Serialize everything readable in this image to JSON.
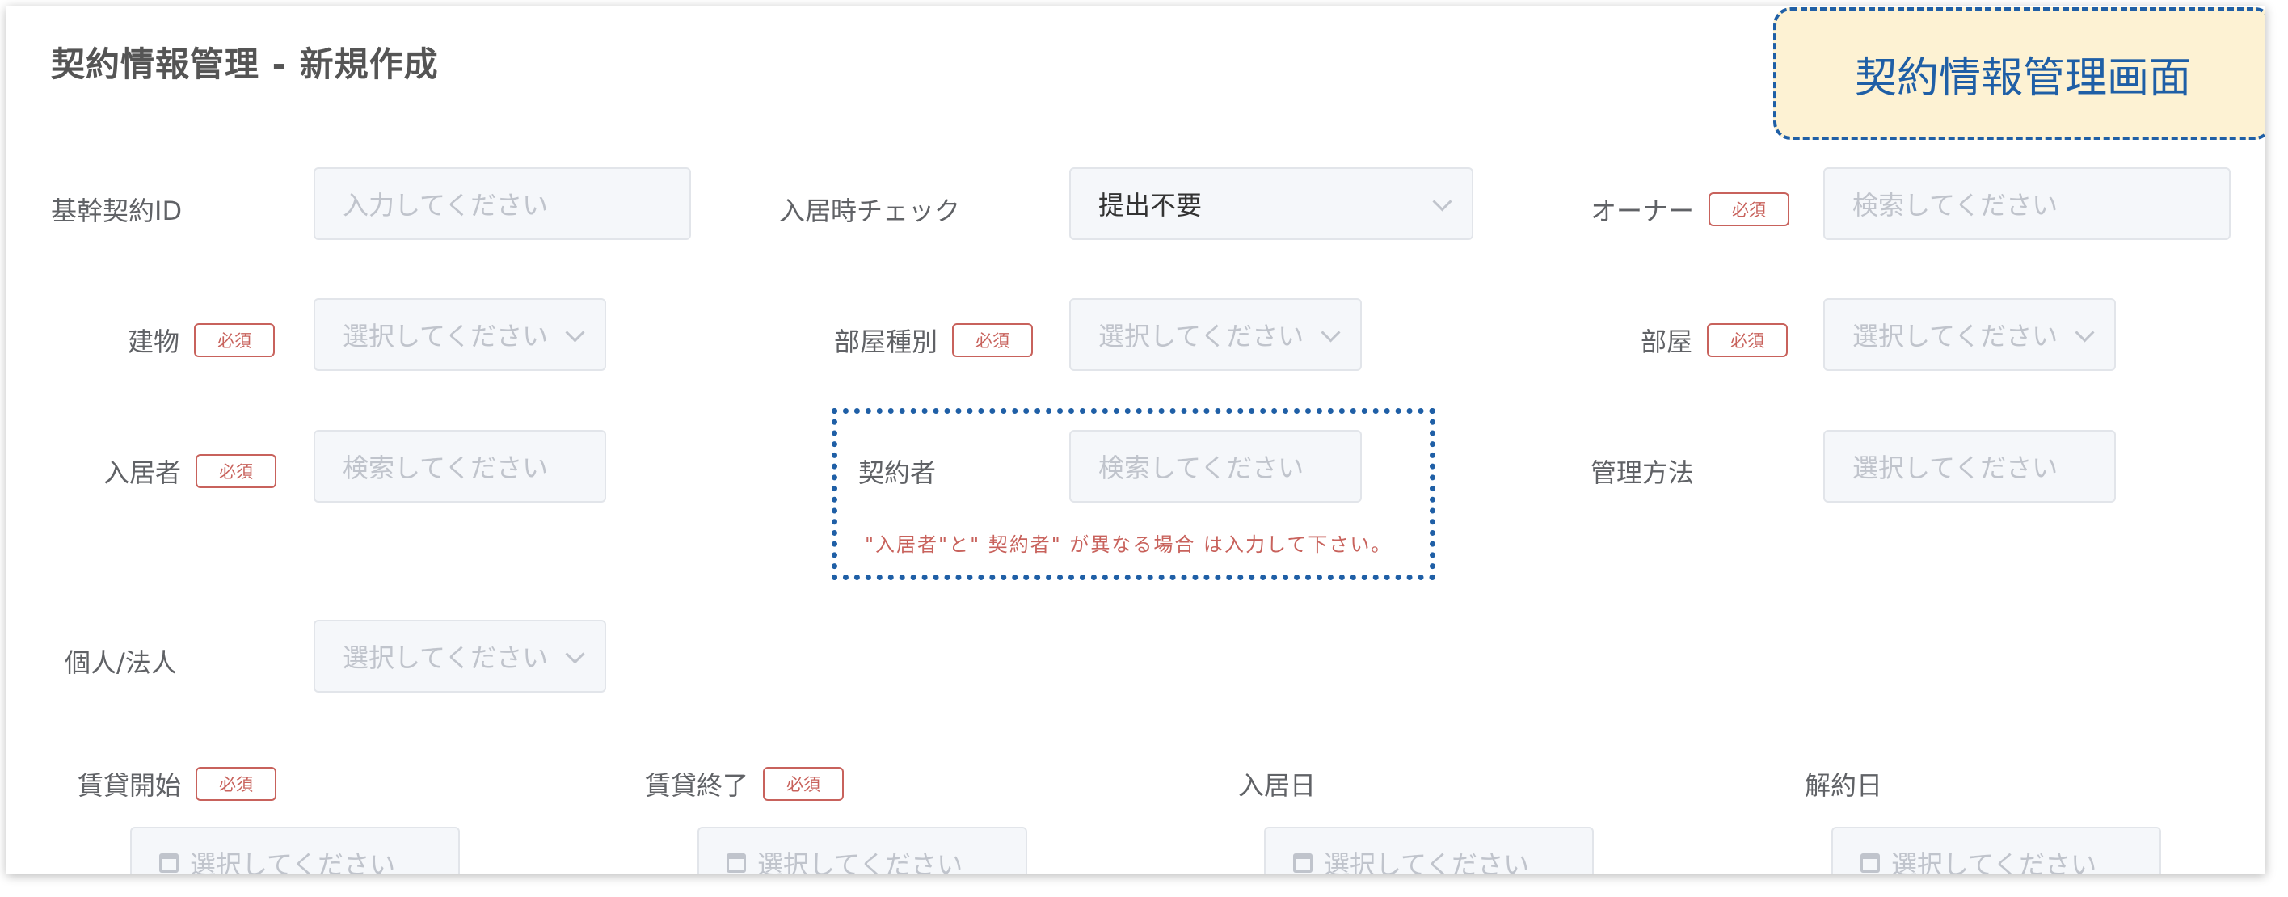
{
  "header": {
    "title": "契約情報管理 - 新規作成"
  },
  "callout": {
    "text": "契約情報管理画面"
  },
  "required_badge": "必須",
  "fields": {
    "base_contract_id": {
      "label": "基幹契約ID",
      "placeholder": "入力してください"
    },
    "move_in_check": {
      "label": "入居時チェック",
      "value": "提出不要"
    },
    "owner": {
      "label": "オーナー",
      "placeholder": "検索してください"
    },
    "building": {
      "label": "建物",
      "placeholder": "選択してください"
    },
    "room_type": {
      "label": "部屋種別",
      "placeholder": "選択してください"
    },
    "room": {
      "label": "部屋",
      "placeholder": "選択してください"
    },
    "resident": {
      "label": "入居者",
      "placeholder": "検索してください"
    },
    "contractor": {
      "label": "契約者",
      "placeholder": "検索してください"
    },
    "management_method": {
      "label": "管理方法",
      "placeholder": "選択してください"
    },
    "individual_corporate": {
      "label": "個人/法人",
      "placeholder": "選択してください"
    },
    "lease_start": {
      "label": "賃貸開始",
      "placeholder": "選択してください"
    },
    "lease_end": {
      "label": "賃貸終了",
      "placeholder": "選択してください"
    },
    "move_in_date": {
      "label": "入居日",
      "placeholder": "選択してください"
    },
    "cancellation_date": {
      "label": "解約日",
      "placeholder": "選択してください"
    }
  },
  "contractor_note": "\"入居者\"と\" 契約者\" が異なる場合 は入力して下さい。",
  "icons": {
    "select": "chevron-down-icon",
    "date": "calendar-icon"
  },
  "colors": {
    "callout_border": "#1f5fa6",
    "callout_bg": "#fdf2d3",
    "required": "#c8625c"
  }
}
